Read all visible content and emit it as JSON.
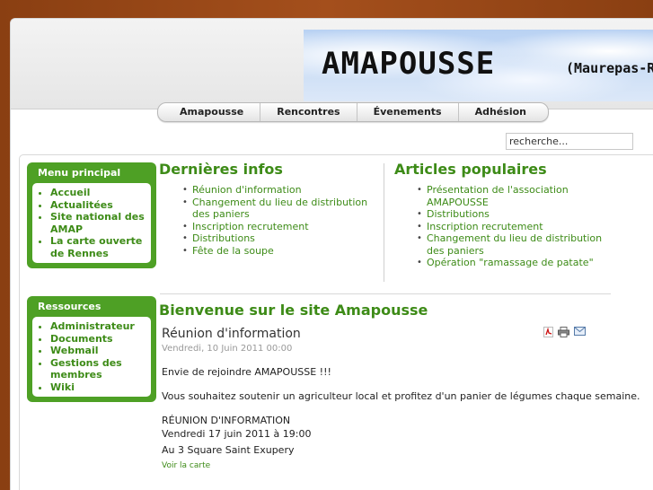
{
  "banner": {
    "title": "AMAPOUSSE",
    "subtitle": "(Maurepas-R"
  },
  "nav": [
    "Amapousse",
    "Rencontres",
    "Évenements",
    "Adhésion"
  ],
  "search": {
    "placeholder": "recherche..."
  },
  "menu_principal": {
    "title": "Menu principal",
    "items": [
      "Accueil",
      "Actualitées",
      "Site national des AMAP",
      "La carte ouverte de Rennes"
    ]
  },
  "ressources": {
    "title": "Ressources",
    "items": [
      "Administrateur",
      "Documents",
      "Webmail",
      "Gestions des membres",
      "Wiki"
    ]
  },
  "dernieres": {
    "title": "Dernières infos",
    "items": [
      "Réunion d'information",
      "Changement du lieu de distribution des paniers",
      "Inscription recrutement",
      "Distributions",
      "Fête de la soupe"
    ]
  },
  "populaires": {
    "title": "Articles populaires",
    "items": [
      "Présentation de l'association AMAPOUSSE",
      "Distributions",
      "Inscription recrutement",
      "Changement du lieu de distribution des paniers",
      "Opération \"ramassage de patate\""
    ]
  },
  "welcome": "Bienvenue sur le site Amapousse",
  "article": {
    "title": "Réunion d'information",
    "date": "Vendredi, 10 Juin 2011 00:00",
    "p1": "Envie de rejoindre AMAPOUSSE !!!",
    "p2": "Vous souhaitez soutenir un agriculteur local et profitez d'un panier de légumes chaque semaine.",
    "p3": "RÉUNION D'INFORMATION",
    "p4": "Vendredi 17 juin 2011 à 19:00",
    "p5": "Au 3 Square Saint Exupery",
    "link": "Voir la carte"
  },
  "icons": [
    "pdf-icon",
    "print-icon",
    "email-icon"
  ],
  "colors": {
    "accent": "#3d8b17",
    "module": "#4ea025",
    "background": "#a44f1c"
  }
}
